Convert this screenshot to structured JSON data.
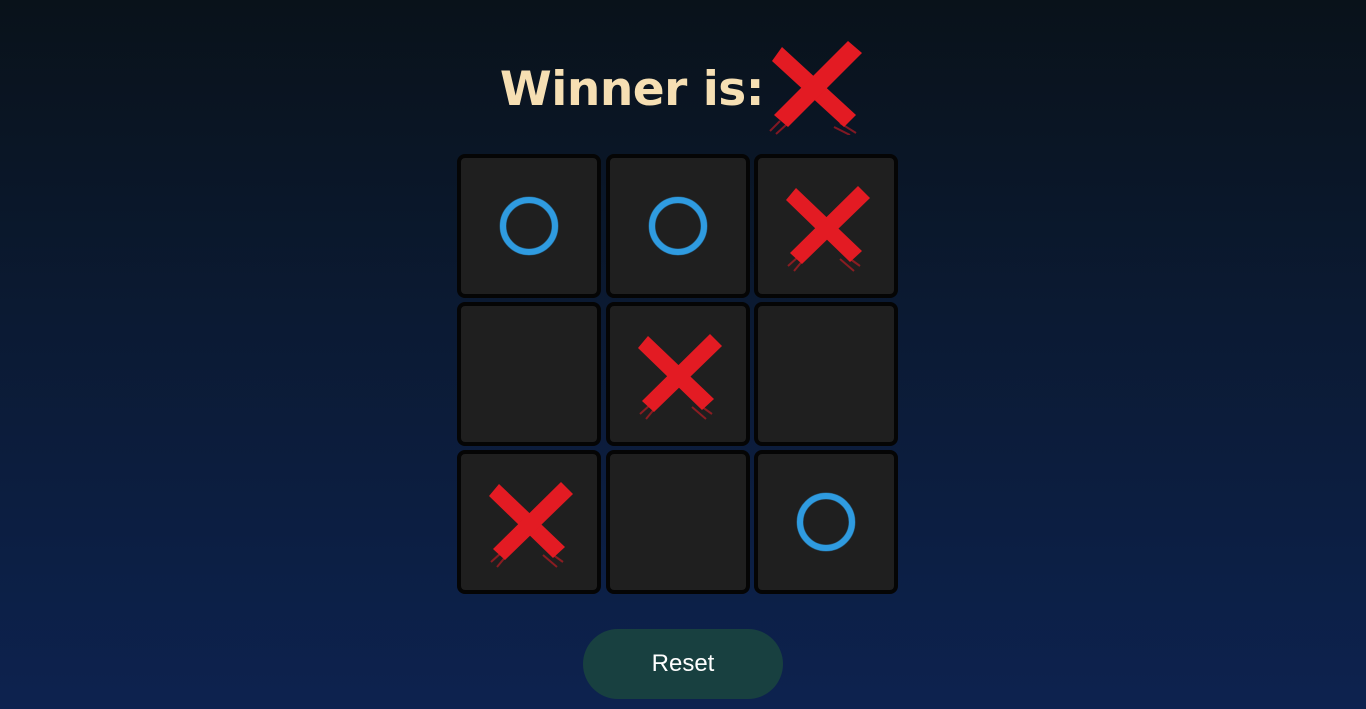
{
  "header": {
    "winner_label": "Winner is:",
    "winner": "X"
  },
  "board": {
    "cells": [
      "O",
      "O",
      "X",
      "",
      "X",
      "",
      "X",
      "",
      "O"
    ]
  },
  "reset_button": {
    "label": "Reset"
  },
  "colors": {
    "x_mark": "#e31b23",
    "o_mark": "#2f9be0",
    "cell_bg": "#1f1f1f",
    "title_text": "#f6dfb3",
    "reset_bg": "#184040"
  },
  "icons": {
    "x": "x-mark-icon",
    "o": "o-mark-icon"
  }
}
